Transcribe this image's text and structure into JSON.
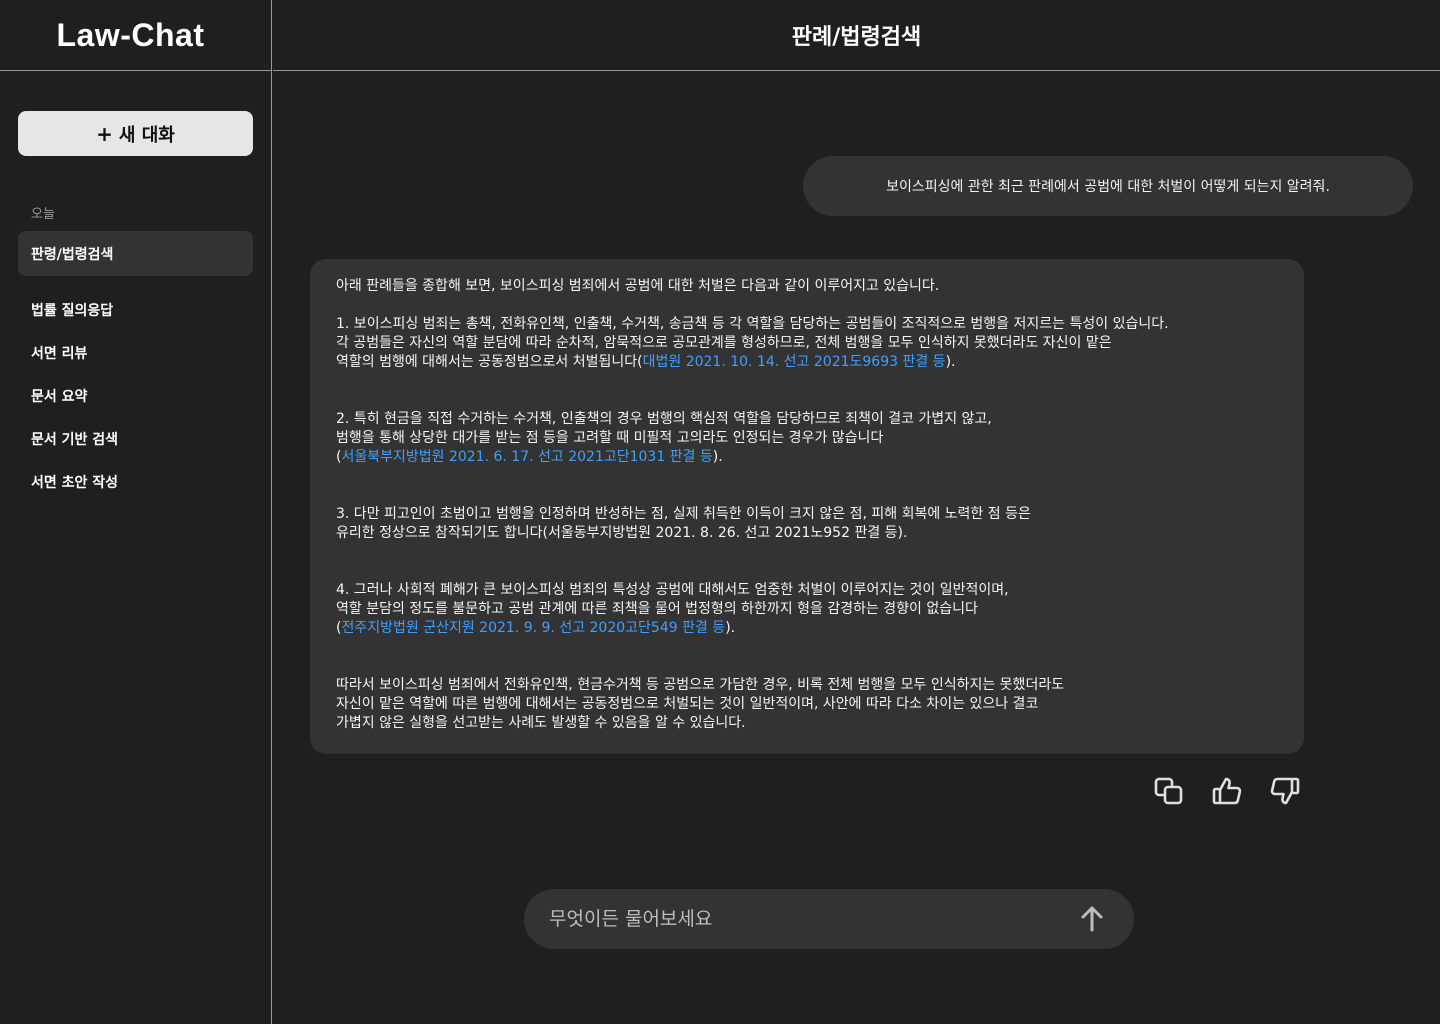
{
  "sidebar": {
    "brand": "Law-Chat",
    "new_chat_plus": "+",
    "new_chat_label": "새 대화",
    "section_today": "오늘",
    "active_item": "판령/법령검색",
    "items": [
      {
        "label": "법률 질의응답"
      },
      {
        "label": "서면 리뷰"
      },
      {
        "label": "문서 요약"
      },
      {
        "label": "문서 기반 검색"
      },
      {
        "label": "서면 초안 작성"
      }
    ]
  },
  "header": {
    "title": "판례/법령검색"
  },
  "conversation": {
    "user_message": "보이스피싱에 관한 최근 판례에서 공범에 대한 처벌이 어떻게 되는지 알려줘.",
    "answer": {
      "intro": "아래 판례들을 종합해 보면, 보이스피싱 범죄에서 공범에 대한 처벌은 다음과 같이 이루어지고 있습니다.",
      "p1_text": "1. 보이스피싱 범죄는 총책, 전화유인책, 인출책, 수거책, 송금책 등 각 역할을 담당하는 공범들이 조직적으로 범행을 저지르는 특성이 있습니다.\n각 공범들은 자신의 역할 분담에 따라 순차적, 암묵적으로 공모관계를 형성하므로, 전체 범행을 모두 인식하지 못했더라도 자신이 맡은\n역할의 범행에 대해서는 공동정범으로서 처벌됩니다(",
      "p1_cite": "대법원 2021. 10. 14. 선고 2021도9693 판결 등",
      "p1_end": ").",
      "p2_text": "2. 특히 현금을 직접 수거하는 수거책, 인출책의 경우 범행의 핵심적 역할을 담당하므로 죄책이 결코 가볍지 않고,\n범행을 통해 상당한 대가를 받는 점 등을 고려할 때 미필적 고의라도 인정되는 경우가 많습니다\n(",
      "p2_cite": "서울북부지방법원 2021. 6. 17. 선고 2021고단1031 판결 등",
      "p2_end": ").",
      "p3_text": "3. 다만 피고인이 초범이고 범행을 인정하며 반성하는 점, 실제 취득한 이득이 크지 않은 점, 피해 회복에 노력한 점 등은\n유리한 정상으로 참작되기도 합니다(서울동부지방법원 2021. 8. 26. 선고 2021노952 판결 등).",
      "p4_text": "4. 그러나 사회적 폐해가 큰 보이스피싱 범죄의 특성상 공범에 대해서도 엄중한 처벌이 이루어지는 것이 일반적이며,\n역할 분담의 정도를 불문하고 공범 관계에 따른 죄책을 물어 법정형의 하한까지 형을 감경하는 경향이 없습니다\n(",
      "p4_cite": "전주지방법원 군산지원 2021. 9. 9. 선고 2020고단549 판결 등",
      "p4_end": ").",
      "conclusion": "따라서 보이스피싱 범죄에서 전화유인책, 현금수거책 등 공범으로 가담한 경우, 비록 전체 범행을 모두 인식하지는 못했더라도\n자신이 맡은 역할에 따른 범행에 대해서는 공동정범으로 처벌되는 것이 일반적이며, 사안에 따라 다소 차이는 있으나 결코\n가볍지 않은 실형을 선고받는 사례도 발생할 수 있음을 알 수 있습니다."
    },
    "actions": [
      {
        "icon": "copy-icon"
      },
      {
        "icon": "thumbs-up-icon"
      },
      {
        "icon": "thumbs-down-icon"
      }
    ]
  },
  "composer": {
    "placeholder": "무엇이든 물어보세요",
    "send_icon": "arrow-up-icon"
  },
  "colors": {
    "background": "#1f1f1f",
    "bubble": "#333333",
    "citation_link": "#3fa0ff",
    "new_chat_button": "#e6e6e6"
  }
}
